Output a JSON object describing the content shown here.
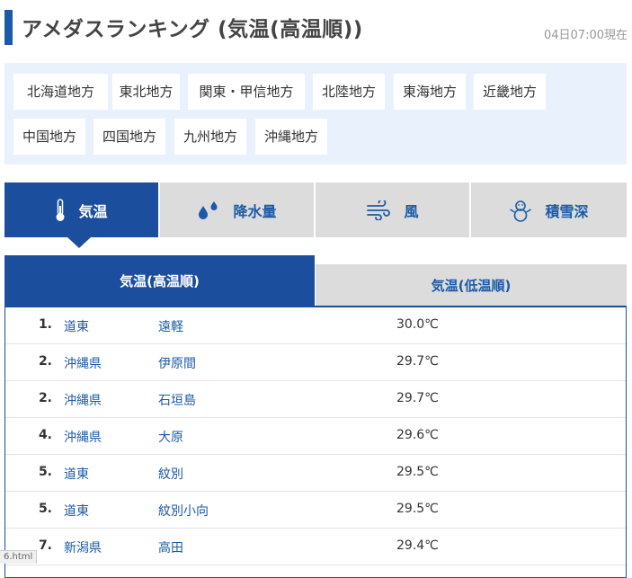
{
  "header": {
    "title": "アメダスランキング (気温(高温順))",
    "timestamp": "04日07:00現在"
  },
  "regions": [
    "北海道地方",
    "東北地方",
    "関東・甲信地方",
    "北陸地方",
    "東海地方",
    "近畿地方",
    "中国地方",
    "四国地方",
    "九州地方",
    "沖縄地方"
  ],
  "tabs": [
    {
      "label": "気温",
      "icon": "thermometer-icon",
      "active": true
    },
    {
      "label": "降水量",
      "icon": "raindrops-icon",
      "active": false
    },
    {
      "label": "風",
      "icon": "wind-icon",
      "active": false
    },
    {
      "label": "積雪深",
      "icon": "snowman-icon",
      "active": false
    }
  ],
  "subtabs": {
    "high": "気温(高温順)",
    "low": "気温(低温順)"
  },
  "ranking": [
    {
      "rank": "1.",
      "pref": "道東",
      "station": "遠軽",
      "value": "30.0℃"
    },
    {
      "rank": "2.",
      "pref": "沖縄県",
      "station": "伊原間",
      "value": "29.7℃"
    },
    {
      "rank": "2.",
      "pref": "沖縄県",
      "station": "石垣島",
      "value": "29.7℃"
    },
    {
      "rank": "4.",
      "pref": "沖縄県",
      "station": "大原",
      "value": "29.6℃"
    },
    {
      "rank": "5.",
      "pref": "道東",
      "station": "紋別",
      "value": "29.5℃"
    },
    {
      "rank": "5.",
      "pref": "道東",
      "station": "紋別小向",
      "value": "29.5℃"
    },
    {
      "rank": "7.",
      "pref": "新潟県",
      "station": "高田",
      "value": "29.4℃"
    }
  ],
  "status_hint": "6.html",
  "colors": {
    "accent": "#1b4f9e",
    "link": "#1b5aa8",
    "region_bg": "#e9f2fc",
    "tab_inactive": "#dcdcdc"
  }
}
